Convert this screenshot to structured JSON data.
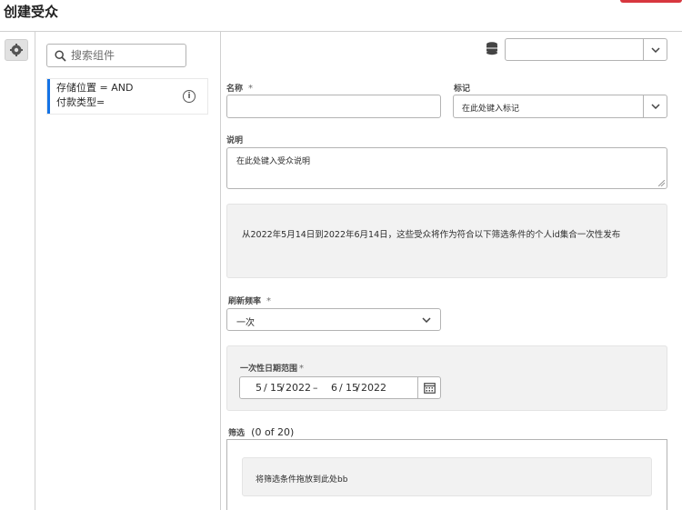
{
  "header": {
    "title": "创建受众"
  },
  "left_panel": {
    "search": {
      "placeholder": "搜索组件"
    },
    "component": {
      "line1": "存储位置 = AND",
      "line2": "付款类型="
    }
  },
  "form": {
    "top_select": {
      "value": ""
    },
    "name": {
      "label": "名称",
      "required_mark": "*",
      "value": ""
    },
    "tags": {
      "label": "标记",
      "placeholder": "在此处键入标记"
    },
    "description": {
      "label": "说明",
      "placeholder": "在此处键入受众说明"
    },
    "info_text": "从2022年5月14日到2022年6月14日，这些受众将作为符合以下筛选条件的个人id集合一次性发布",
    "refresh": {
      "label": "刷新频率",
      "required_mark": "*",
      "value": "一次"
    },
    "date_range": {
      "label": "一次性日期范围",
      "required_mark": "*",
      "start": {
        "month": "5",
        "day": "15",
        "year": "2022"
      },
      "separator": "–",
      "end": {
        "month": "6",
        "day": "15",
        "year": "2022"
      },
      "slash": "/"
    },
    "filter": {
      "label": "筛选",
      "count": "(0 of 20)",
      "drop_hint": "将筛选条件拖放到此处bb"
    }
  },
  "icons": [
    "gear-icon",
    "search-icon",
    "info-icon",
    "database-icon",
    "chevron-down-icon",
    "calendar-icon"
  ]
}
